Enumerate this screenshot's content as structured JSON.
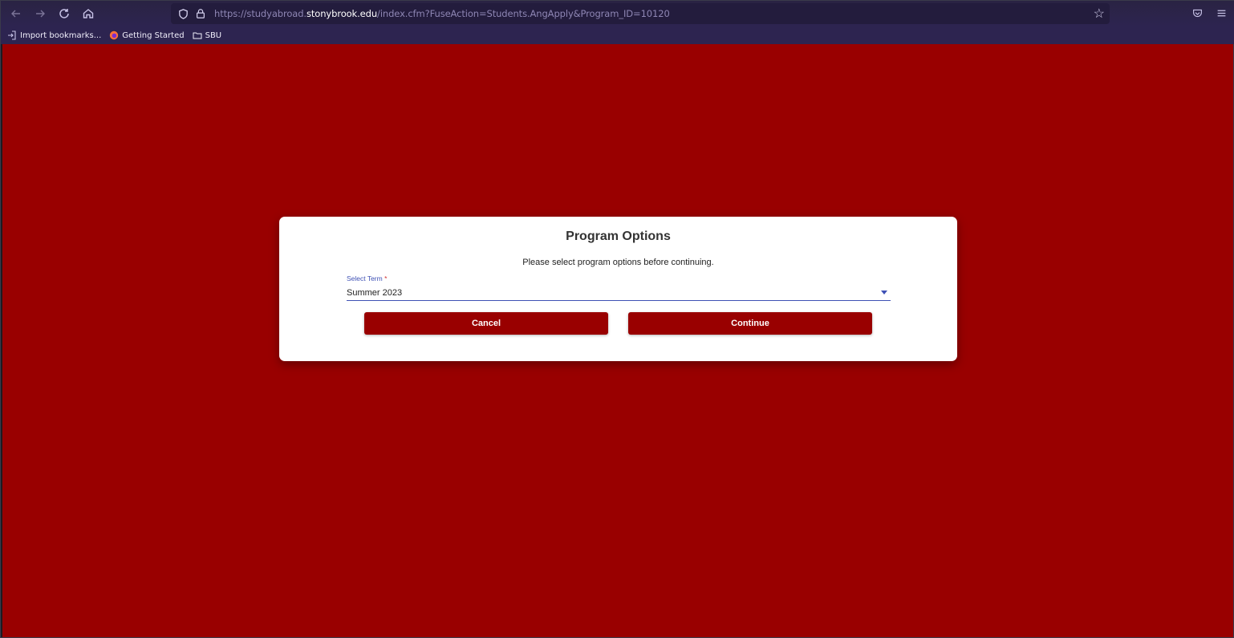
{
  "browser": {
    "url_prefix": "https://studyabroad.",
    "url_domain": "stonybrook.edu",
    "url_path": "/index.cfm?FuseAction=Students.AngApply&Program_ID=10120"
  },
  "bookmarks": [
    {
      "label": "Import bookmarks..."
    },
    {
      "label": "Getting Started"
    },
    {
      "label": "SBU"
    }
  ],
  "dialog": {
    "title": "Program Options",
    "subtitle": "Please select program options before continuing.",
    "term_label": "Select Term",
    "term_required": "*",
    "term_value": "Summer 2023",
    "cancel_label": "Cancel",
    "continue_label": "Continue"
  },
  "colors": {
    "page_background": "#990000",
    "accent": "#3f51b5",
    "button": "#990000"
  }
}
